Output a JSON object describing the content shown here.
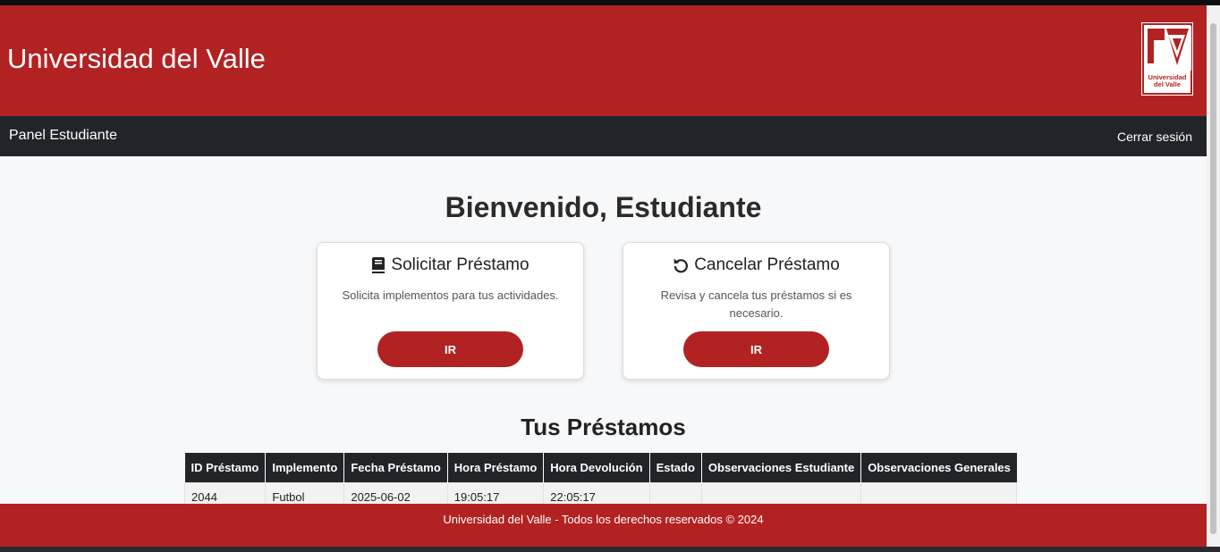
{
  "header": {
    "title": "Universidad del Valle",
    "logo_text_line1": "Universidad",
    "logo_text_line2": "del Valle"
  },
  "nav": {
    "brand": "Panel Estudiante",
    "logout": "Cerrar sesión"
  },
  "main": {
    "welcome": "Bienvenido, Estudiante",
    "cards": [
      {
        "title": "Solicitar Préstamo",
        "icon": "book-icon",
        "text": "Solicita implementos para tus actividades.",
        "button": "IR"
      },
      {
        "title": "Cancelar Préstamo",
        "icon": "undo-icon",
        "text": "Revisa y cancela tus préstamos si es necesario.",
        "button": "IR"
      }
    ],
    "loans_title": "Tus Préstamos",
    "table": {
      "headers": [
        "ID Préstamo",
        "Implemento",
        "Fecha Préstamo",
        "Hora Préstamo",
        "Hora Devolución",
        "Estado",
        "Observaciones Estudiante",
        "Observaciones Generales"
      ],
      "rows": [
        [
          "2044",
          "Futbol",
          "2025-06-02",
          "19:05:17",
          "22:05:17",
          "",
          "",
          ""
        ]
      ]
    }
  },
  "footer": {
    "text": "Universidad del Valle - Todos los derechos reservados © 2024"
  },
  "colors": {
    "brand_red": "#b22222",
    "nav_dark": "#212529",
    "background": "#f7f8fa"
  }
}
